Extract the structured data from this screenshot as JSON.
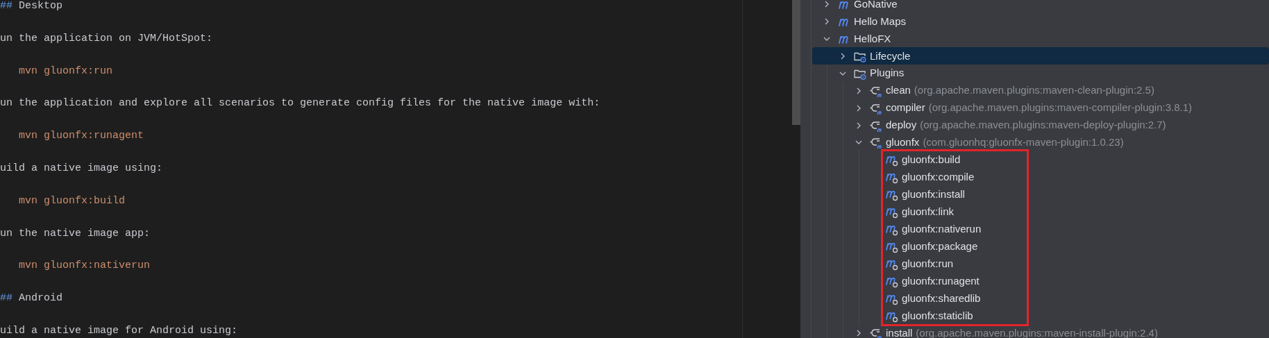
{
  "editor": {
    "lines": [
      {
        "kind": "heading",
        "marker": "##",
        "text": "Desktop"
      },
      {
        "kind": "text",
        "text": "un the application on JVM/HotSpot:"
      },
      {
        "kind": "code",
        "text": "mvn gluonfx:run"
      },
      {
        "kind": "text",
        "text": "un the application and explore all scenarios to generate config files for the native image with:"
      },
      {
        "kind": "code",
        "text": "mvn gluonfx:runagent"
      },
      {
        "kind": "text",
        "text": "uild a native image using:"
      },
      {
        "kind": "code",
        "text": "mvn gluonfx:build"
      },
      {
        "kind": "text",
        "text": "un the native image app:"
      },
      {
        "kind": "code",
        "text": "mvn gluonfx:nativerun"
      },
      {
        "kind": "heading",
        "marker": "##",
        "text": "Android"
      },
      {
        "kind": "text",
        "text": "uild a native image for Android using:"
      }
    ]
  },
  "maven_tree": [
    {
      "kind": "module",
      "label": "GoNative",
      "expanded": false,
      "selected": false
    },
    {
      "kind": "module",
      "label": "Hello Maps",
      "expanded": false,
      "selected": false
    },
    {
      "kind": "module",
      "label": "HelloFX",
      "expanded": true,
      "selected": false,
      "children": [
        {
          "kind": "folder",
          "label": "Lifecycle",
          "expanded": false,
          "selected": true
        },
        {
          "kind": "folder",
          "label": "Plugins",
          "expanded": true,
          "selected": false,
          "children": [
            {
              "kind": "plugin",
              "label": "clean",
              "detail": "(org.apache.maven.plugins:maven-clean-plugin:2.5)",
              "expanded": false,
              "selected": false
            },
            {
              "kind": "plugin",
              "label": "compiler",
              "detail": "(org.apache.maven.plugins:maven-compiler-plugin:3.8.1)",
              "expanded": false,
              "selected": false
            },
            {
              "kind": "plugin",
              "label": "deploy",
              "detail": "(org.apache.maven.plugins:maven-deploy-plugin:2.7)",
              "expanded": false,
              "selected": false
            },
            {
              "kind": "plugin",
              "label": "gluonfx",
              "detail": "(com.gluonhq:gluonfx-maven-plugin:1.0.23)",
              "expanded": true,
              "selected": false,
              "boxed": true,
              "children": [
                {
                  "kind": "goal",
                  "label": "gluonfx:build",
                  "selected": false
                },
                {
                  "kind": "goal",
                  "label": "gluonfx:compile",
                  "selected": false
                },
                {
                  "kind": "goal",
                  "label": "gluonfx:install",
                  "selected": false
                },
                {
                  "kind": "goal",
                  "label": "gluonfx:link",
                  "selected": false
                },
                {
                  "kind": "goal",
                  "label": "gluonfx:nativerun",
                  "selected": false
                },
                {
                  "kind": "goal",
                  "label": "gluonfx:package",
                  "selected": false
                },
                {
                  "kind": "goal",
                  "label": "gluonfx:run",
                  "selected": false
                },
                {
                  "kind": "goal",
                  "label": "gluonfx:runagent",
                  "selected": false
                },
                {
                  "kind": "goal",
                  "label": "gluonfx:sharedlib",
                  "selected": false
                },
                {
                  "kind": "goal",
                  "label": "gluonfx:staticlib",
                  "selected": false
                }
              ]
            },
            {
              "kind": "plugin",
              "label": "install",
              "detail": "(org.apache.maven.plugins:maven-install-plugin:2.4)",
              "expanded": false,
              "selected": false
            }
          ]
        }
      ]
    }
  ]
}
